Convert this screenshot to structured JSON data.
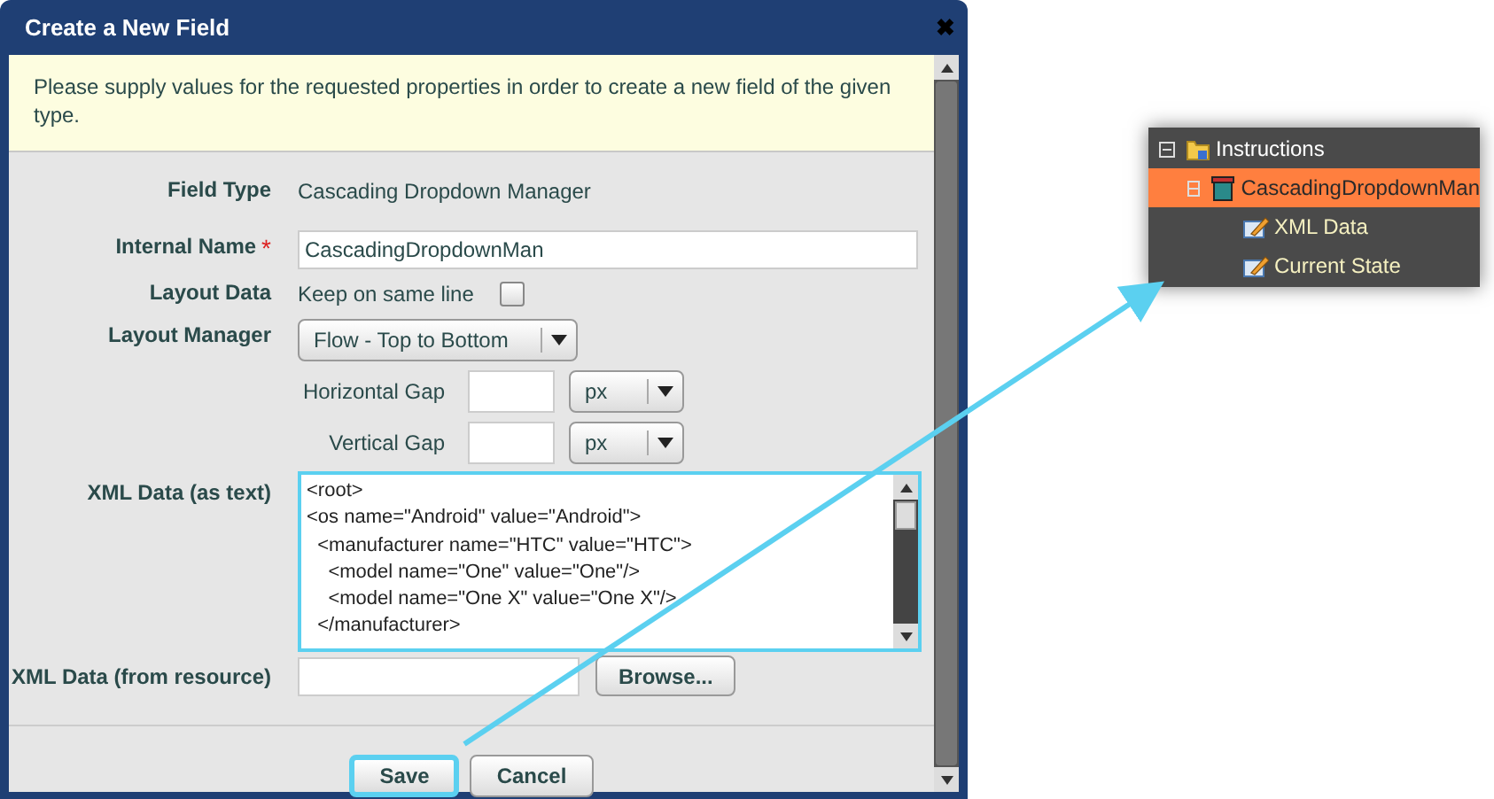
{
  "dialog": {
    "title": "Create a New Field",
    "close": "✖",
    "info": "Please supply values for the requested properties in order to create a new field of the given type.",
    "field_type": {
      "label": "Field Type",
      "value": "Cascading Dropdown Manager"
    },
    "internal_name": {
      "label": "Internal Name",
      "required_mark": "*",
      "value": "CascadingDropdownMan"
    },
    "layout_data": {
      "label": "Layout Data",
      "option": "Keep on same line",
      "checked": false
    },
    "layout_manager": {
      "label": "Layout Manager",
      "value": "Flow - Top to Bottom"
    },
    "gaps": [
      {
        "label": "Horizontal Gap",
        "unit": "px"
      },
      {
        "label": "Vertical Gap",
        "unit": "px"
      }
    ],
    "xml_text": {
      "label": "XML Data (as text)",
      "highlighted": true,
      "lines": [
        "<root>",
        "<os name=\"Android\" value=\"Android\">",
        "  <manufacturer name=\"HTC\" value=\"HTC\">",
        "    <model name=\"One\" value=\"One\"/>",
        "    <model name=\"One X\" value=\"One X\"/>",
        "  </manufacturer>"
      ]
    },
    "xml_resource": {
      "label": "XML Data (from resource)",
      "button": "Browse..."
    },
    "buttons": [
      {
        "label": "Save",
        "highlighted": true
      },
      {
        "label": "Cancel",
        "highlighted": false
      }
    ]
  },
  "tree": {
    "items": [
      {
        "label": "Instructions",
        "kind": "folder",
        "expanded": true,
        "selected": false,
        "children": [
          {
            "label": "CascadingDropdownMan",
            "kind": "box",
            "expanded": true,
            "selected": true,
            "children": [
              {
                "label": "XML Data",
                "kind": "edit",
                "selected": false
              },
              {
                "label": "Current State",
                "kind": "edit",
                "selected": false
              }
            ]
          }
        ]
      }
    ]
  }
}
